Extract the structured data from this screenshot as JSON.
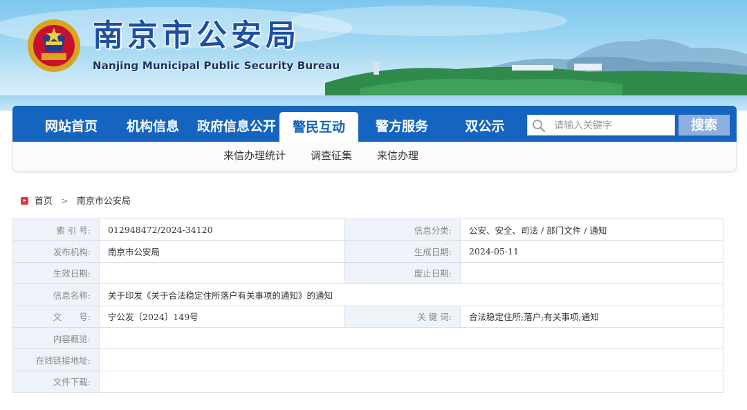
{
  "header": {
    "title": "南京市公安局",
    "subtitle": "Nanjing Municipal Public Security Bureau",
    "emblem_icon": "police-emblem-icon"
  },
  "nav": {
    "items": [
      {
        "label": "网站首页",
        "active": false
      },
      {
        "label": "机构信息",
        "active": false
      },
      {
        "label": "政府信息公开",
        "active": false
      },
      {
        "label": "警民互动",
        "active": true
      },
      {
        "label": "警方服务",
        "active": false
      },
      {
        "label": "双公示",
        "active": false
      }
    ],
    "search_placeholder": "请输入关键字",
    "search_button": "搜索",
    "color": "#1565c0"
  },
  "subnav": {
    "items": [
      "来信办理统计",
      "调查征集",
      "来信办理"
    ]
  },
  "breadcrumb": {
    "home": "首页",
    "separator": ">",
    "current": "南京市公安局"
  },
  "info": {
    "index_label": "索 引 号:",
    "index_value": "012948472/2024-34120",
    "category_label": "信息分类:",
    "category_value": "公安、安全、司法 / 部门文件 / 通知",
    "publisher_label": "发布机构:",
    "publisher_value": "南京市公安局",
    "created_label": "生成日期:",
    "created_value": "2024-05-11",
    "effective_label": "生效日期:",
    "effective_value": "",
    "expire_label": "废止日期:",
    "expire_value": "",
    "name_label": "信息名称:",
    "name_value": "关于印发《关于合法稳定住所落户有关事项的通知》的通知",
    "docno_label": "文　　号:",
    "docno_value": "宁公发〔2024〕149号",
    "keywords_label": "关 键 词:",
    "keywords_value": "合法稳定住所;落户;有关事项;通知",
    "summary_label": "内容概览:",
    "summary_value": "",
    "link_label": "在线链接地址:",
    "link_value": "",
    "download_label": "文件下载:",
    "download_value": ""
  }
}
